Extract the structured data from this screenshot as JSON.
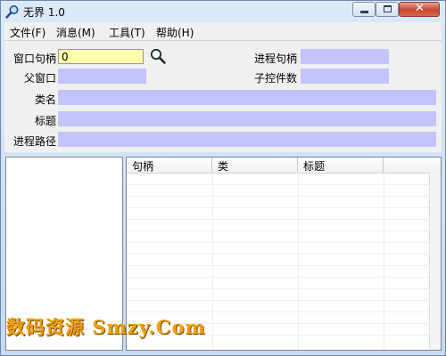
{
  "window": {
    "title": "无界 1.0",
    "icon": "magnifier-app-icon",
    "controls": {
      "minimize": "minimize-icon",
      "maximize": "maximize-icon",
      "close": "✕"
    }
  },
  "menu": {
    "items": [
      {
        "label": "文件(F)"
      },
      {
        "label": "消息(M)"
      },
      {
        "label": "工具(T)"
      },
      {
        "label": "帮助(H)"
      }
    ]
  },
  "panel": {
    "window_handle": {
      "label": "窗口句柄",
      "value": "0"
    },
    "process_handle": {
      "label": "进程句柄",
      "value": ""
    },
    "parent_window": {
      "label": "父窗口",
      "value": ""
    },
    "child_count": {
      "label": "子控件数",
      "value": ""
    },
    "class_name": {
      "label": "类名",
      "value": ""
    },
    "title": {
      "label": "标题",
      "value": ""
    },
    "process_path": {
      "label": "进程路径",
      "value": ""
    },
    "search_icon": "magnifier-icon"
  },
  "grid": {
    "columns": [
      "句柄",
      "类",
      "标题"
    ],
    "rows": []
  },
  "colors": {
    "field_fill": "#c2c4fb",
    "input_fill": "#ffffb0",
    "watermark": "#f0a010"
  },
  "watermark": {
    "text": "数码资源 Smzy.Com"
  }
}
